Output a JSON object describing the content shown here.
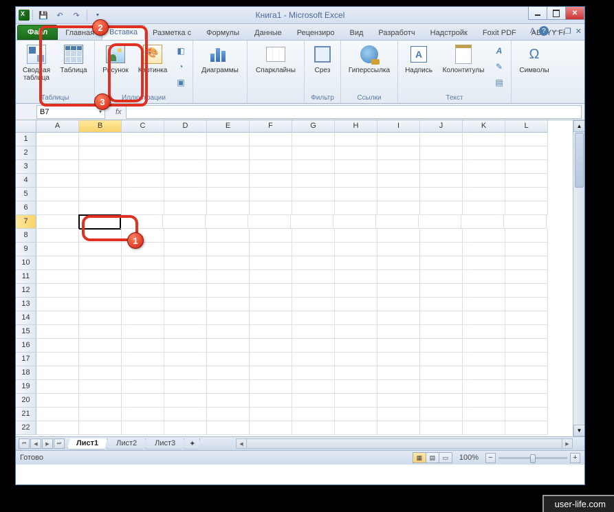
{
  "title": "Книга1 - Microsoft Excel",
  "tabs": {
    "file": "Файл",
    "home": "Главная",
    "insert": "Вставка",
    "pagelayout": "Разметка с",
    "formulas": "Формулы",
    "data": "Данные",
    "review": "Рецензиро",
    "view": "Вид",
    "developer": "Разработч",
    "addins": "Надстройк",
    "foxit": "Foxit PDF",
    "abbyy": "ABBYY Fi"
  },
  "ribbon": {
    "tables": {
      "label": "Таблицы",
      "pivot": "Сводная\nтаблица",
      "table": "Таблица"
    },
    "illustrations": {
      "label": "Иллюстрации",
      "picture": "Рисунок",
      "clipart": "Картинка"
    },
    "charts": {
      "label": "",
      "chart": "Диаграммы"
    },
    "sparklines": {
      "label": "",
      "spark": "Спарклайны"
    },
    "filter": {
      "label": "Фильтр",
      "slicer": "Срез"
    },
    "links": {
      "label": "Ссылки",
      "hyper": "Гиперссылка"
    },
    "text": {
      "label": "Текст",
      "textbox": "Надпись",
      "header": "Колонтитулы"
    },
    "symbols": {
      "label": "",
      "sym": "Символы"
    }
  },
  "namebox": "B7",
  "fx": "fx",
  "columns": [
    "A",
    "B",
    "C",
    "D",
    "E",
    "F",
    "G",
    "H",
    "I",
    "J",
    "K",
    "L"
  ],
  "rows": [
    "1",
    "2",
    "3",
    "4",
    "5",
    "6",
    "7",
    "8",
    "9",
    "10",
    "11",
    "12",
    "13",
    "14",
    "15",
    "16",
    "17",
    "18",
    "19",
    "20",
    "21",
    "22"
  ],
  "selected": {
    "col": 1,
    "row": 6
  },
  "sheets": {
    "s1": "Лист1",
    "s2": "Лист2",
    "s3": "Лист3"
  },
  "status": "Готово",
  "zoom": "100%",
  "callouts": {
    "c1": "1",
    "c2": "2",
    "c3": "3"
  },
  "watermark": "user-life.com"
}
